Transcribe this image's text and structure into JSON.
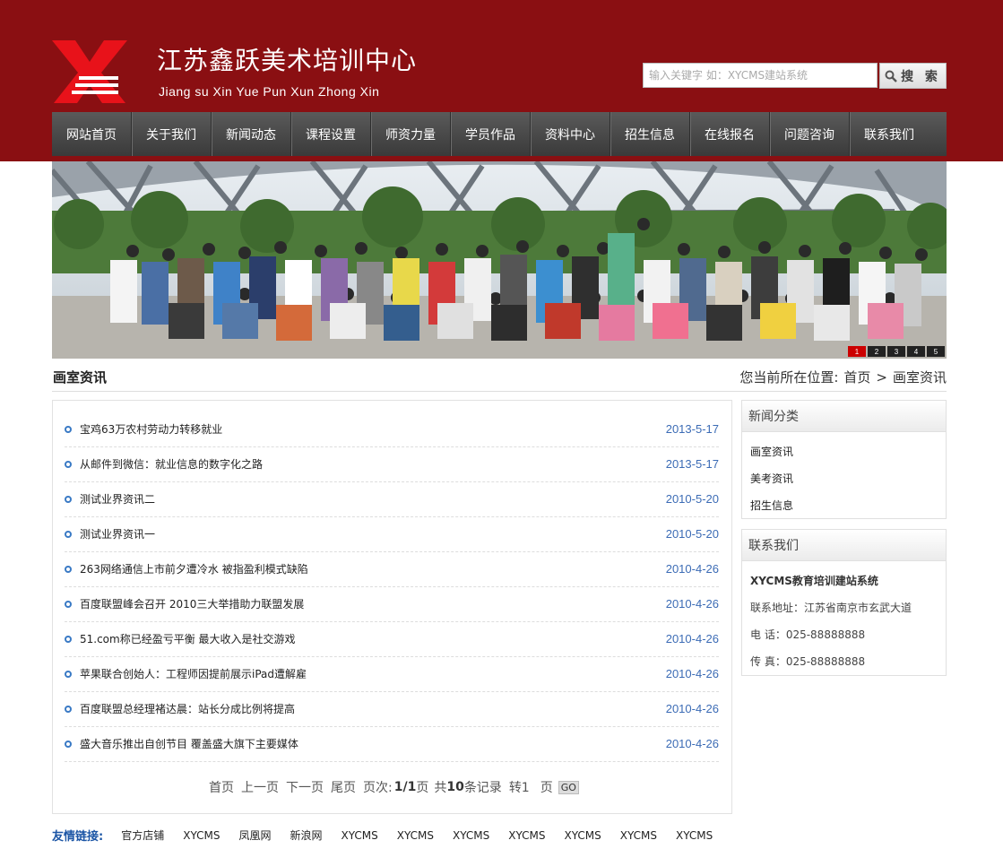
{
  "header": {
    "title": "江苏鑫跃美术培训中心",
    "subtitle": "Jiang su Xin Yue Pun Xun Zhong Xin",
    "search_placeholder": "输入关键字  如：XYCMS建站系统",
    "search_button": "搜 索",
    "brand_color": "#8a0f12"
  },
  "nav": {
    "items": [
      "网站首页",
      "关于我们",
      "新闻动态",
      "课程设置",
      "师资力量",
      "学员作品",
      "资料中心",
      "招生信息",
      "在线报名",
      "问题咨询",
      "联系我们"
    ]
  },
  "banner": {
    "pages": [
      "1",
      "2",
      "3",
      "4",
      "5"
    ],
    "active_page": "1"
  },
  "section": {
    "title": "画室资讯",
    "breadcrumb_prefix": "您当前所在位置:",
    "breadcrumb_home": "首页",
    "breadcrumb_sep": ">",
    "breadcrumb_current": "画室资讯"
  },
  "news": [
    {
      "title": "宝鸡63万农村劳动力转移就业",
      "date": "2013-5-17"
    },
    {
      "title": "从邮件到微信：就业信息的数字化之路",
      "date": "2013-5-17"
    },
    {
      "title": "测试业界资讯二",
      "date": "2010-5-20"
    },
    {
      "title": "测试业界资讯一",
      "date": "2010-5-20"
    },
    {
      "title": "263网络通信上市前夕遭冷水 被指盈利模式缺陷",
      "date": "2010-4-26"
    },
    {
      "title": "百度联盟峰会召开 2010三大举措助力联盟发展",
      "date": "2010-4-26"
    },
    {
      "title": "51.com称已经盈亏平衡 最大收入是社交游戏",
      "date": "2010-4-26"
    },
    {
      "title": "苹果联合创始人：工程师因提前展示iPad遭解雇",
      "date": "2010-4-26"
    },
    {
      "title": "百度联盟总经理褚达晨：站长分成比例将提高",
      "date": "2010-4-26"
    },
    {
      "title": "盛大音乐推出自创节目 覆盖盛大旗下主要媒体",
      "date": "2010-4-26"
    }
  ],
  "pager": {
    "first": "首页",
    "prev": "上一页",
    "next": "下一页",
    "last": "尾页",
    "page_label": "页次:",
    "page_value": "1/1",
    "page_unit": "页",
    "total_prefix": "共",
    "total_value": "10",
    "total_suffix": "条记录",
    "goto_label": "转1",
    "goto_unit": "页",
    "go": "GO"
  },
  "sidebar": {
    "category_title": "新闻分类",
    "categories": [
      "画室资讯",
      "美考资讯",
      "招生信息"
    ],
    "contact_title": "联系我们",
    "contact_name": "XYCMS教育培训建站系统",
    "contact_address": "联系地址：江苏省南京市玄武大道",
    "contact_phone": "电  话：025-88888888",
    "contact_fax": "传  真：025-88888888"
  },
  "links": {
    "label": "友情链接:",
    "items": [
      "官方店铺",
      "XYCMS",
      "凤凰网",
      "新浪网",
      "XYCMS",
      "XYCMS",
      "XYCMS",
      "XYCMS",
      "XYCMS",
      "XYCMS",
      "XYCMS"
    ]
  }
}
